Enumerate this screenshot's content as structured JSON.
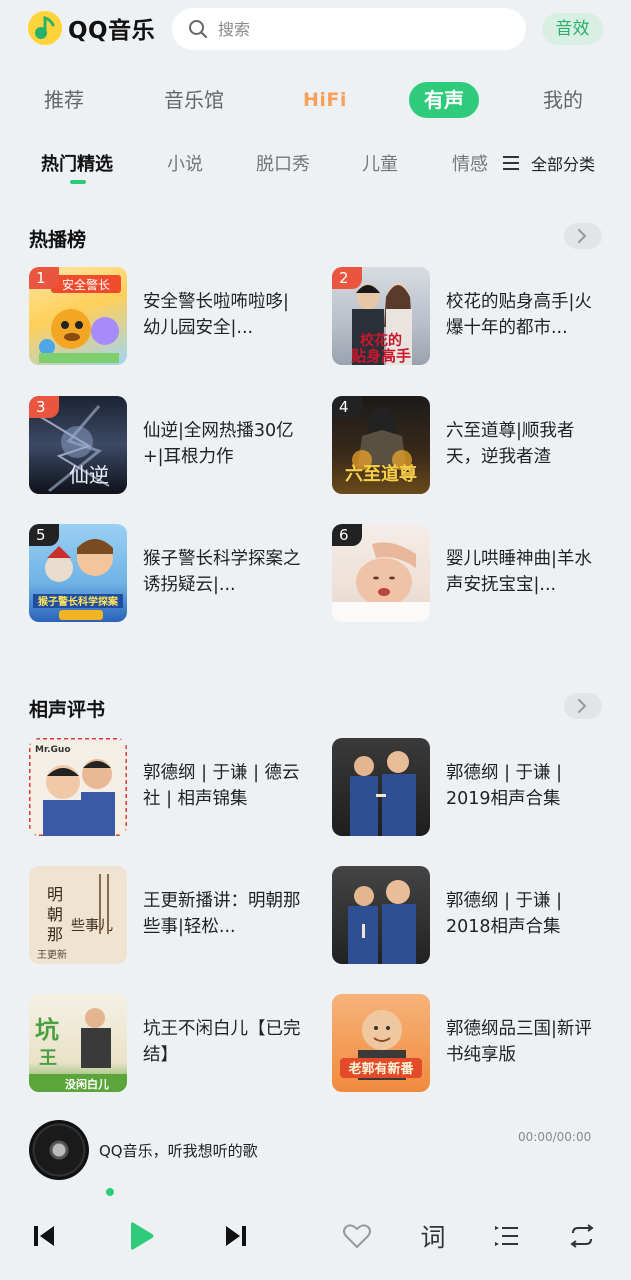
{
  "header": {
    "app_name": "QQ音乐",
    "search_placeholder": "搜索",
    "sfx_label": "音效"
  },
  "main_nav": [
    {
      "label": "推荐"
    },
    {
      "label": "音乐馆"
    },
    {
      "label": "HiFi"
    },
    {
      "label": "有声",
      "active": true
    },
    {
      "label": "我的"
    }
  ],
  "sub_tabs": [
    {
      "label": "热门精选",
      "active": true
    },
    {
      "label": "小说"
    },
    {
      "label": "脱口秀"
    },
    {
      "label": "儿童"
    },
    {
      "label": "情感"
    }
  ],
  "all_categories_label": "全部分类",
  "hot_section": {
    "title": "热播榜",
    "items": [
      {
        "rank": "1",
        "title": "安全警长啦咘啦哆|幼儿园安全|...",
        "cover_text": "安全警长"
      },
      {
        "rank": "2",
        "title": "校花的贴身高手|火爆十年的都市...",
        "cover_text": "校花的贴身高手"
      },
      {
        "rank": "3",
        "title": "仙逆|全网热播30亿+|耳根力作",
        "cover_text": "仙逆"
      },
      {
        "rank": "4",
        "title": "六至道尊|顺我者天，逆我者渣",
        "cover_text": "六至道尊"
      },
      {
        "rank": "5",
        "title": "猴子警长科学探案之诱拐疑云|...",
        "cover_text": "猴子警长科学探案"
      },
      {
        "rank": "6",
        "title": "婴儿哄睡神曲|羊水声安抚宝宝|...",
        "cover_text": ""
      }
    ]
  },
  "crosstalk_section": {
    "title": "相声评书",
    "items": [
      {
        "title": "郭德纲 | 于谦 | 德云社 | 相声锦集",
        "cover_text": ""
      },
      {
        "title": "郭德纲 | 于谦 | 2019相声合集",
        "cover_text": ""
      },
      {
        "title": "王更新播讲：明朝那些事|轻松...",
        "cover_text": "明朝那些事儿"
      },
      {
        "title": "郭德纲 | 于谦 | 2018相声合集",
        "cover_text": ""
      },
      {
        "title": "坑王不闲白儿【已完结】",
        "cover_text": "没闲白儿"
      },
      {
        "title": "郭德纲品三国|新评书纯享版",
        "cover_text": "老郭有新番"
      }
    ]
  },
  "player": {
    "now_playing": "QQ音乐，听我想听的歌",
    "time": "00:00/00:00",
    "lyrics_label": "词"
  },
  "colors": {
    "accent": "#2ecc7a",
    "rank_red": "#e9553f",
    "background": "#eef1f4"
  }
}
